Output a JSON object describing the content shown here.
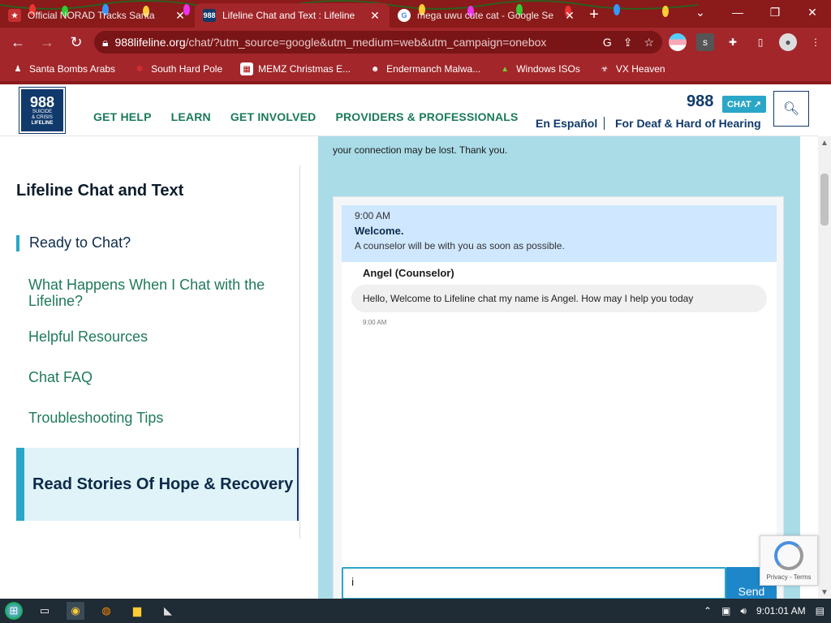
{
  "browser": {
    "tabs": [
      {
        "title": "Official NORAD Tracks Santa",
        "favicon": "santa-favicon",
        "active": false
      },
      {
        "title": "Lifeline Chat and Text : Lifeline",
        "favicon": "988-favicon",
        "active": true
      },
      {
        "title": "mega uwu cute cat - Google Se",
        "favicon": "google-favicon",
        "active": false
      }
    ],
    "url": {
      "host": "988lifeline.org",
      "rest": "/chat/?utm_source=google&utm_medium=web&utm_campaign=onebox"
    },
    "bookmarks": [
      {
        "label": "Santa Bombs Arabs",
        "icon": "santa-bookmark-icon"
      },
      {
        "label": "South Hard Pole",
        "icon": "snowflake-bookmark-icon"
      },
      {
        "label": "MEMZ Christmas E...",
        "icon": "memz-bookmark-icon"
      },
      {
        "label": "Endermanch Malwa...",
        "icon": "enderman-bookmark-icon"
      },
      {
        "label": "Windows ISOs",
        "icon": "tree-bookmark-icon"
      },
      {
        "label": "VX Heaven",
        "icon": "vx-bookmark-icon"
      }
    ],
    "colors": {
      "frame": "#8b1a1a",
      "active_tab": "#a2262a"
    }
  },
  "site": {
    "logo": {
      "number": "988",
      "line1": "SUICIDE",
      "line2": "& CRISIS",
      "line3": "LIFELINE"
    },
    "nav": [
      "GET HELP",
      "LEARN",
      "GET INVOLVED",
      "PROVIDERS & PROFESSIONALS"
    ],
    "brand_number": "988",
    "chat_badge": "CHAT",
    "lang_link": "En Español",
    "deaf_link": "For Deaf & Hard of Hearing",
    "colors": {
      "brand_blue": "#103a6b",
      "teal": "#2aa6c8",
      "green": "#1f7a5b"
    }
  },
  "sidebar": {
    "title": "Lifeline Chat and Text",
    "items": [
      "Ready to Chat?",
      "What Happens When I Chat with the Lifeline?",
      "Helpful Resources",
      "Chat FAQ",
      "Troubleshooting Tips"
    ],
    "active_index": 0,
    "story": "Read Stories Of Hope & Recovery"
  },
  "chat": {
    "notice": "your connection may be lost. Thank you.",
    "welcome": {
      "time": "9:00 AM",
      "heading": "Welcome.",
      "body": "A counselor will be with you as soon as possible."
    },
    "sender": "Angel (Counselor)",
    "message": "Hello, Welcome to Lifeline chat my name is Angel. How may I help you today",
    "message_time": "9:00 AM",
    "input_value": "i",
    "send_label": "Send"
  },
  "recaptcha": {
    "text": "Privacy - Terms"
  },
  "taskbar": {
    "time": "9:01:01 AM"
  }
}
